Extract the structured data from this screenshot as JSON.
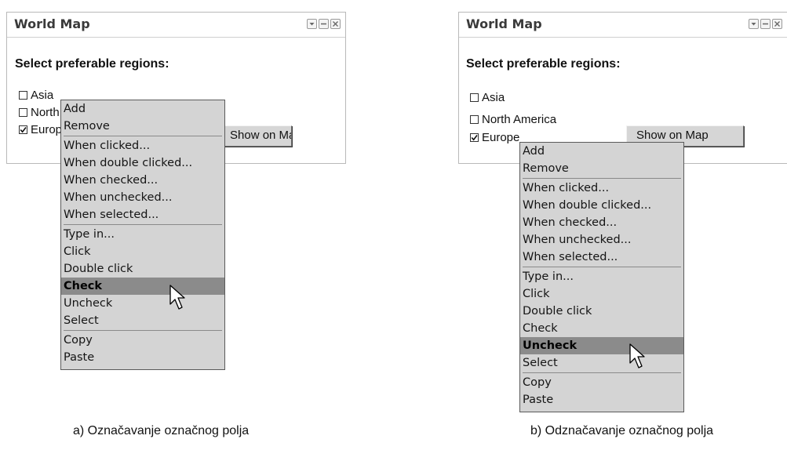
{
  "panel_a": {
    "window_title": "World Map",
    "heading": "Select preferable regions:",
    "checkboxes": [
      {
        "label": "Asia",
        "checked": false
      },
      {
        "label": "North America",
        "checked": false
      },
      {
        "label": "Europe",
        "checked": true
      }
    ],
    "button_label": "Show on Map",
    "menu": {
      "items": [
        "Add",
        "Remove",
        "When clicked...",
        "When double clicked...",
        "When checked...",
        "When unchecked...",
        "When selected...",
        "Type in...",
        "Click",
        "Double click",
        "Check",
        "Uncheck",
        "Select",
        "Copy",
        "Paste"
      ],
      "highlighted": "Check"
    },
    "caption_letter": "a)",
    "caption_text": " Označavanje označnog polja"
  },
  "panel_b": {
    "window_title": "World Map",
    "heading": "Select preferable regions:",
    "checkboxes": [
      {
        "label": "Asia",
        "checked": false
      },
      {
        "label": "North America",
        "checked": false
      },
      {
        "label": "Europe",
        "checked": true
      }
    ],
    "button_label": "Show on Map",
    "menu": {
      "items": [
        "Add",
        "Remove",
        "When clicked...",
        "When double clicked...",
        "When checked...",
        "When unchecked...",
        "When selected...",
        "Type in...",
        "Click",
        "Double click",
        "Check",
        "Uncheck",
        "Select",
        "Copy",
        "Paste"
      ],
      "highlighted": "Uncheck"
    },
    "caption_letter": "b)",
    "caption_text": " Odznačavanje označnog polja"
  },
  "icons": {
    "window_buttons": [
      "dropdown-icon",
      "minimize-icon",
      "close-icon"
    ],
    "pointer": "arrow-cursor-icon"
  },
  "colors": {
    "menu_background": "#d4d4d4",
    "menu_highlight": "#8b8b8b",
    "window_border": "#b9b9b9"
  }
}
